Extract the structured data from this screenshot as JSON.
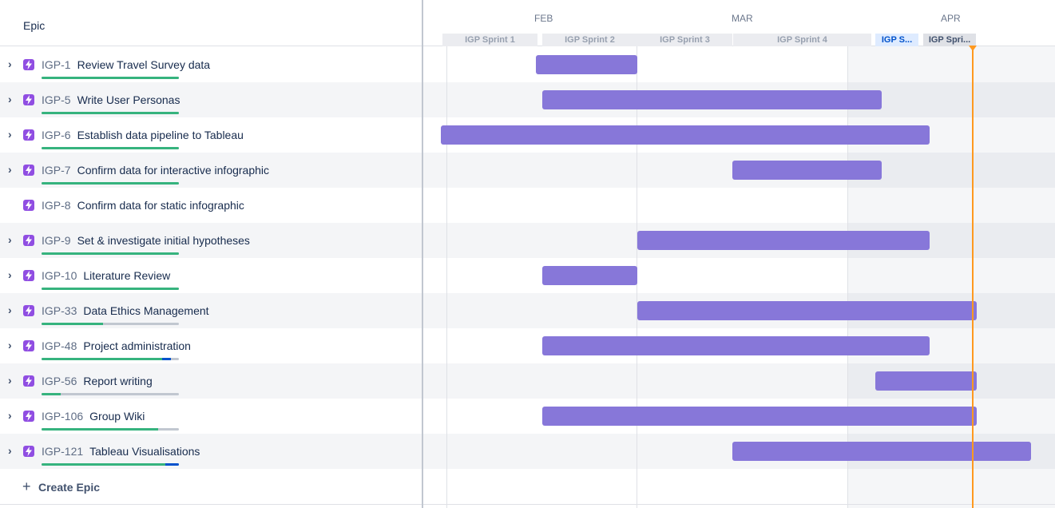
{
  "epic_column_label": "Epic",
  "create_epic_label": "Create Epic",
  "colors": {
    "bar": "#8777d9",
    "progress_done": "#36b37e",
    "progress_in_progress": "#0052cc",
    "today_marker": "#ff991f",
    "epic_icon": "#904ee2"
  },
  "months": [
    "FEB",
    "MAR",
    "APR"
  ],
  "sprints": [
    {
      "label": "IGP Sprint 1",
      "state": "closed"
    },
    {
      "label": "IGP Sprint 2",
      "state": "closed"
    },
    {
      "label": "IGP Sprint 3",
      "state": "closed"
    },
    {
      "label": "IGP Sprint 4",
      "state": "closed"
    },
    {
      "label": "IGP S...",
      "state": "active"
    },
    {
      "label": "IGP Spri...",
      "state": "future"
    }
  ],
  "epics": [
    {
      "key": "IGP-1",
      "title": "Review Travel Survey data",
      "expandable": true,
      "progress_done": 1.0,
      "progress_in_progress": 0.0
    },
    {
      "key": "IGP-5",
      "title": "Write User Personas",
      "expandable": true,
      "progress_done": 1.0,
      "progress_in_progress": 0.0
    },
    {
      "key": "IGP-6",
      "title": "Establish data pipeline to Tableau",
      "expandable": true,
      "progress_done": 1.0,
      "progress_in_progress": 0.0
    },
    {
      "key": "IGP-7",
      "title": "Confirm data for interactive infographic",
      "expandable": true,
      "progress_done": 1.0,
      "progress_in_progress": 0.0
    },
    {
      "key": "IGP-8",
      "title": "Confirm data for static infographic",
      "expandable": false,
      "progress_done": null,
      "progress_in_progress": null
    },
    {
      "key": "IGP-9",
      "title": "Set & investigate initial hypotheses",
      "expandable": true,
      "progress_done": 1.0,
      "progress_in_progress": 0.0
    },
    {
      "key": "IGP-10",
      "title": "Literature Review",
      "expandable": true,
      "progress_done": 1.0,
      "progress_in_progress": 0.0
    },
    {
      "key": "IGP-33",
      "title": "Data Ethics Management",
      "expandable": true,
      "progress_done": 0.45,
      "progress_in_progress": 0.0
    },
    {
      "key": "IGP-48",
      "title": "Project administration",
      "expandable": true,
      "progress_done": 0.88,
      "progress_in_progress": 0.06
    },
    {
      "key": "IGP-56",
      "title": "Report writing",
      "expandable": true,
      "progress_done": 0.14,
      "progress_in_progress": 0.0
    },
    {
      "key": "IGP-106",
      "title": "Group Wiki",
      "expandable": true,
      "progress_done": 0.85,
      "progress_in_progress": 0.0
    },
    {
      "key": "IGP-121",
      "title": "Tableau Visualisations",
      "expandable": true,
      "progress_done": 0.9,
      "progress_in_progress": 0.1
    }
  ]
}
